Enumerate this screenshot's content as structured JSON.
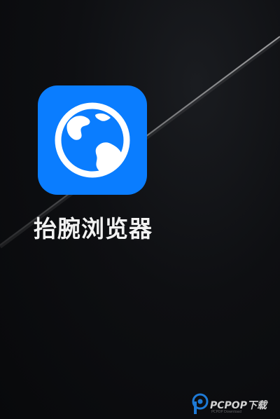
{
  "app": {
    "label": "抬腕浏览器",
    "icon": "globe-icon",
    "icon_bg": "#0a7dff"
  },
  "watermark": {
    "brand": "PCPOP下载",
    "sub": "PCPOP Download"
  }
}
